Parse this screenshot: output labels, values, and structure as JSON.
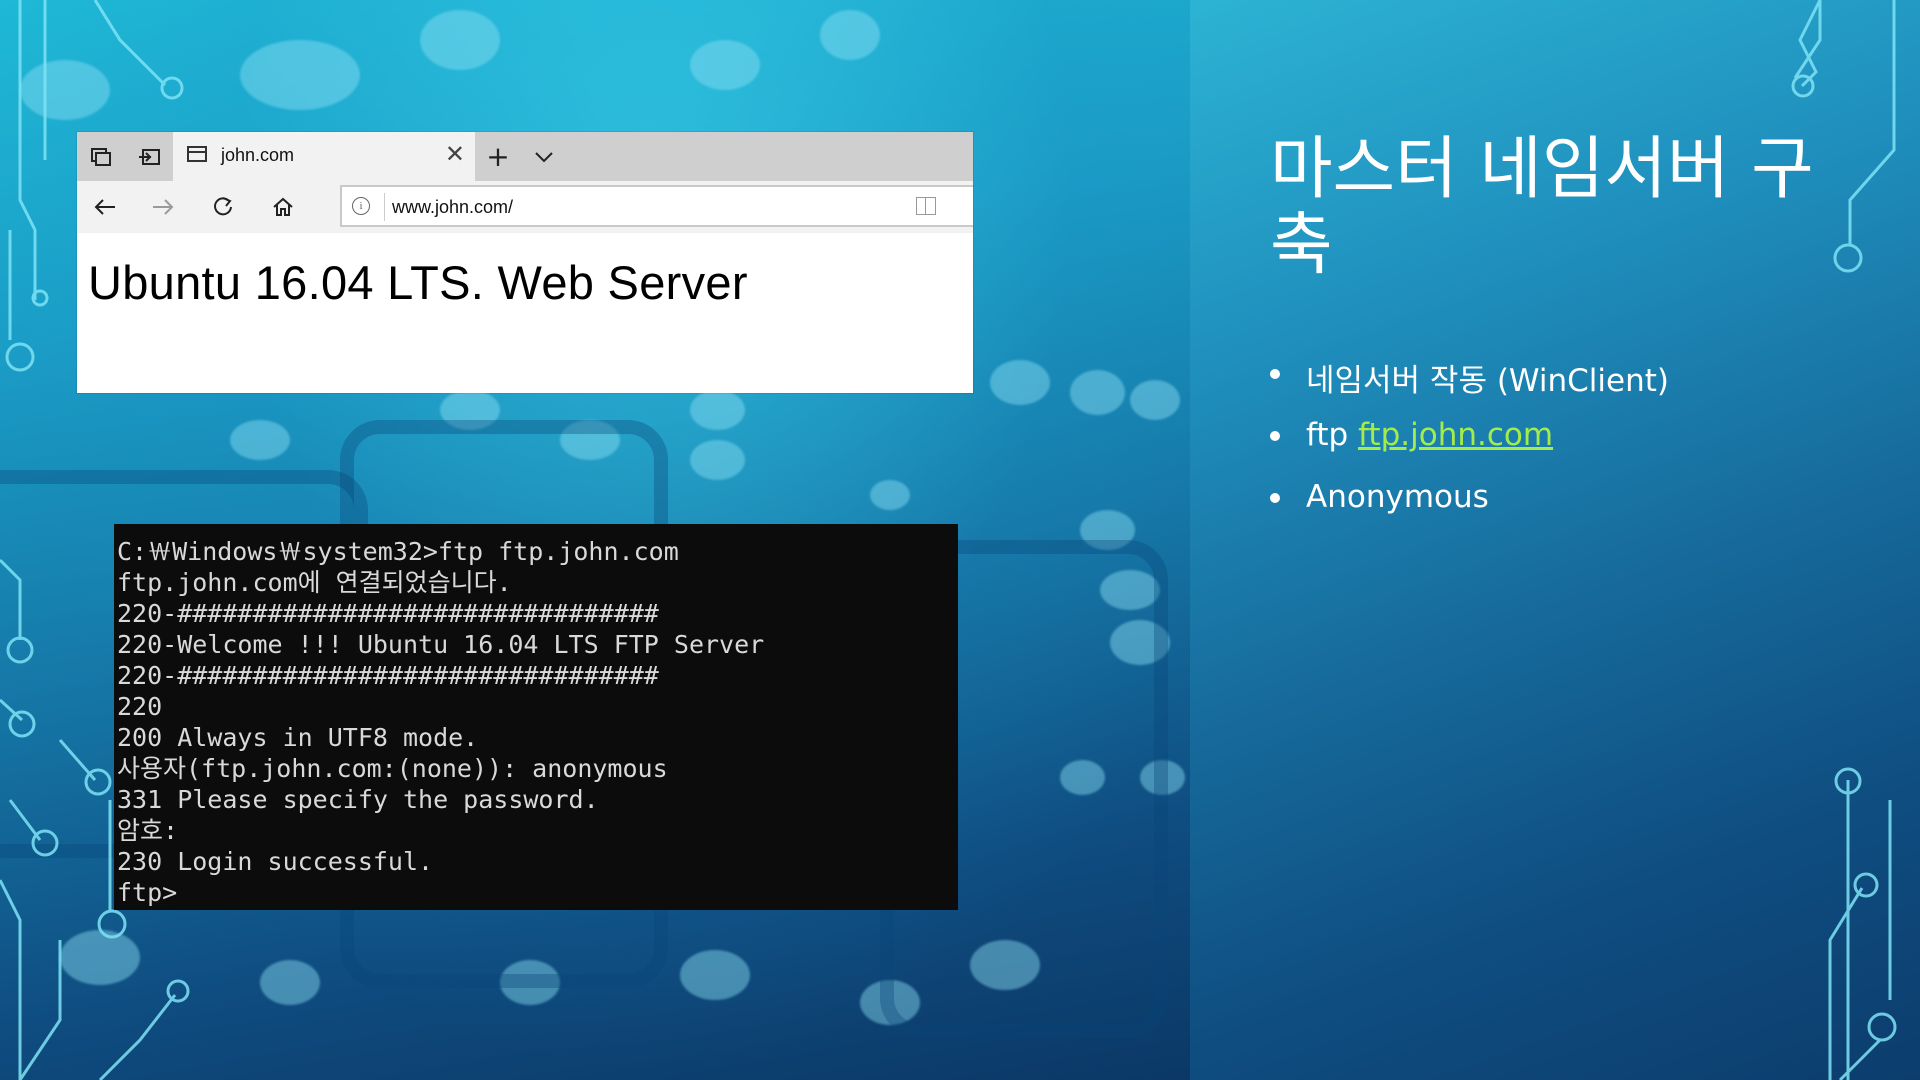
{
  "browser": {
    "tab_title": "john.com",
    "url": "www.john.com/",
    "page_heading": "Ubuntu 16.04 LTS. Web Server",
    "icons": [
      "tab-actions-icon",
      "tab-aside-icon",
      "page-icon",
      "close-icon",
      "plus-icon",
      "chevron-down-icon",
      "back-arrow-icon",
      "forward-arrow-icon",
      "refresh-icon",
      "home-icon",
      "info-icon",
      "reading-view-icon"
    ]
  },
  "console": {
    "lines": [
      "C:￦Windows￦system32>ftp ftp.john.com",
      "ftp.john.com에 연결되었습니다.",
      "220-################################",
      "220-Welcome !!! Ubuntu 16.04 LTS FTP Server",
      "220-################################",
      "220",
      "200 Always in UTF8 mode.",
      "사용자(ftp.john.com:(none)): anonymous",
      "331 Please specify the password.",
      "암호:",
      "230 Login successful.",
      "ftp>"
    ]
  },
  "slide": {
    "title": "마스터 네임서버 구축",
    "bullets": [
      {
        "text": "네임서버 작동 (WinClient)"
      },
      {
        "prefix": "ftp ",
        "link": "ftp.john.com"
      },
      {
        "text": "Anonymous"
      }
    ],
    "link_color": "#a4ec4c"
  }
}
